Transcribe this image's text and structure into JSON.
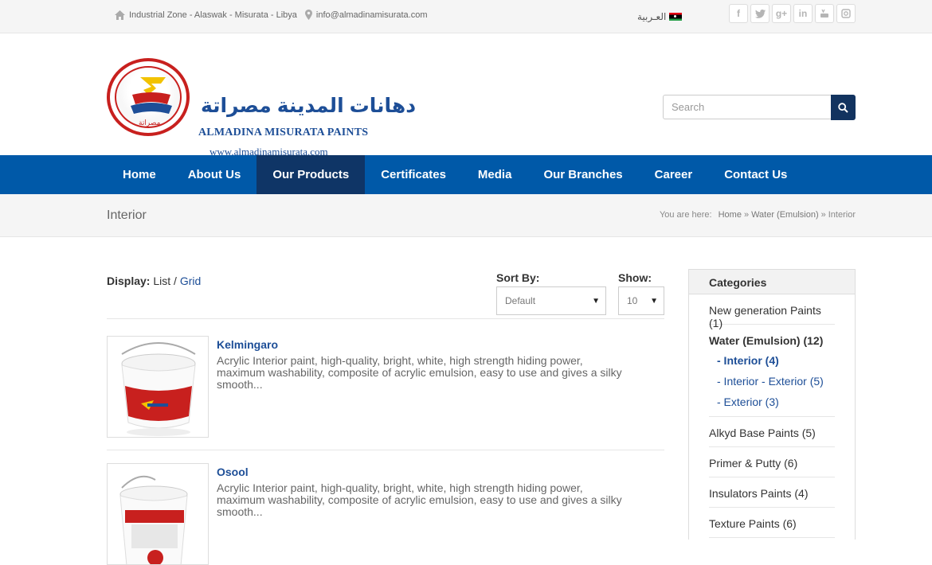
{
  "topbar": {
    "address": "Industrial Zone - Alaswak - Misurata - Libya",
    "email": "info@almadinamisurata.com",
    "language": "العـربية",
    "social": [
      "facebook-icon",
      "twitter-icon",
      "google-plus-icon",
      "linkedin-icon",
      "youtube-icon",
      "instagram-icon"
    ]
  },
  "header": {
    "logo_arabic": "دهانات المدينة مصراتة",
    "logo_english": "ALMADINA MISURATA PAINTS",
    "logo_url": "www.almadinamisurata.com",
    "search_placeholder": "Search"
  },
  "nav": {
    "items": [
      "Home",
      "About Us",
      "Our Products",
      "Certificates",
      "Media",
      "Our Branches",
      "Career",
      "Contact Us"
    ],
    "active": "Our Products"
  },
  "page": {
    "title": "Interior",
    "breadcrumb_label": "You are here:",
    "breadcrumb": [
      "Home",
      "»",
      "Water (Emulsion)",
      "»",
      "Interior"
    ]
  },
  "listing": {
    "display_label": "Display:",
    "display_list": "List",
    "display_slash": "/",
    "display_grid": "Grid",
    "sort_label": "Sort By:",
    "sort_value": "Default",
    "show_label": "Show:",
    "show_value": "10",
    "products": [
      {
        "name": "Kelmingaro",
        "description": "Acrylic Interior paint, high-quality, bright, white, high strength hiding power, maximum washability, composite of acrylic emulsion, easy to use and gives a silky smooth..."
      },
      {
        "name": "Osool",
        "description": "Acrylic Interior paint, high-quality, bright, white, high strength hiding power, maximum washability, composite of acrylic emulsion, easy to use and gives a silky smooth..."
      }
    ]
  },
  "sidebar": {
    "title": "Categories",
    "categories": [
      {
        "name": "New generation Paints",
        "count": "(1)"
      },
      {
        "name": "Water (Emulsion) (12)",
        "subs": [
          "- Interior (4)",
          "- Interior - Exterior (5)",
          "- Exterior (3)"
        ]
      },
      {
        "name": "Alkyd Base Paints",
        "count": "(5)"
      },
      {
        "name": "Primer & Putty",
        "count": "(6)"
      },
      {
        "name": "Insulators Paints",
        "count": "(4)"
      },
      {
        "name": "Texture Paints",
        "count": "(6)"
      }
    ]
  },
  "colors": {
    "nav_bg": "#0059a8",
    "nav_active": "#0f3566",
    "link": "#1d4e97",
    "brand_red": "#c8201e"
  }
}
